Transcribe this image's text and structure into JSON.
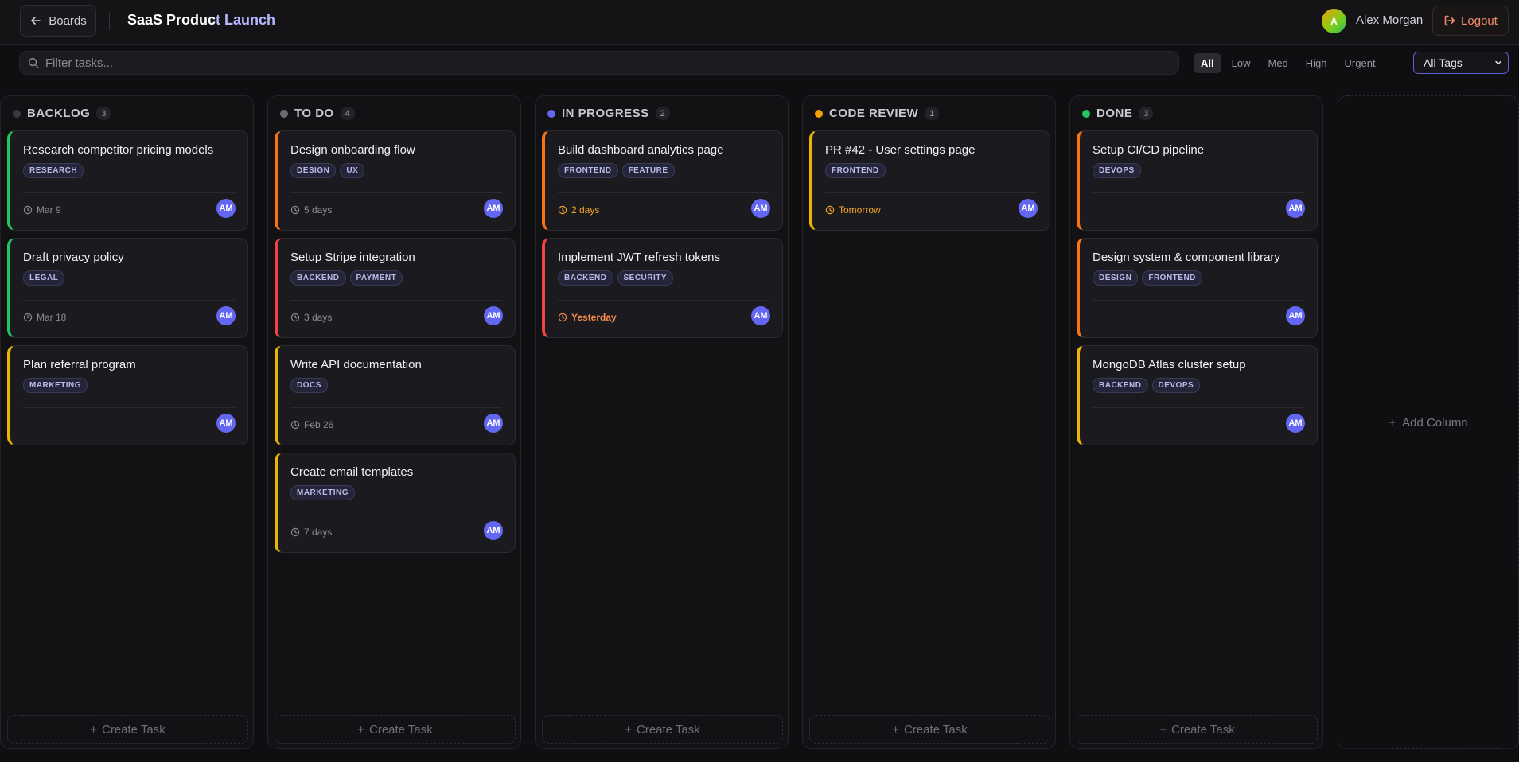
{
  "header": {
    "back_label": "Boards",
    "title_main": "SaaS Produc",
    "title_accent": "t Launch",
    "user_initial": "A",
    "user_name": "Alex Morgan",
    "logout_label": "Logout"
  },
  "toolbar": {
    "search_placeholder": "Filter tasks...",
    "priorities": [
      "All",
      "Low",
      "Med",
      "High",
      "Urgent"
    ],
    "active_priority": "All",
    "tag_filter_value": "All Tags"
  },
  "columns": [
    {
      "title": "BACKLOG",
      "count": "3",
      "dot_color": "#3a3a40",
      "cards": [
        {
          "title": "Research competitor pricing models",
          "tags": [
            "RESEARCH"
          ],
          "due": "Mar 9",
          "due_style": "normal",
          "border": "#22c55e",
          "assignee": "AM"
        },
        {
          "title": "Draft privacy policy",
          "tags": [
            "LEGAL"
          ],
          "due": "Mar 18",
          "due_style": "normal",
          "border": "#22c55e",
          "assignee": "AM"
        },
        {
          "title": "Plan referral program",
          "tags": [
            "MARKETING"
          ],
          "due": "",
          "due_style": "none",
          "border": "#eab308",
          "assignee": "AM"
        }
      ]
    },
    {
      "title": "TO DO",
      "count": "4",
      "dot_color": "#6b6b74",
      "cards": [
        {
          "title": "Design onboarding flow",
          "tags": [
            "DESIGN",
            "UX"
          ],
          "due": "5 days",
          "due_style": "normal",
          "border": "#f97316",
          "assignee": "AM"
        },
        {
          "title": "Setup Stripe integration",
          "tags": [
            "BACKEND",
            "PAYMENT"
          ],
          "due": "3 days",
          "due_style": "normal",
          "border": "#ef4444",
          "assignee": "AM"
        },
        {
          "title": "Write API documentation",
          "tags": [
            "DOCS"
          ],
          "due": "Feb 26",
          "due_style": "normal",
          "border": "#eab308",
          "assignee": "AM"
        },
        {
          "title": "Create email templates",
          "tags": [
            "MARKETING"
          ],
          "due": "7 days",
          "due_style": "normal",
          "border": "#eab308",
          "assignee": "AM"
        }
      ]
    },
    {
      "title": "IN PROGRESS",
      "count": "2",
      "dot_color": "#6366f1",
      "cards": [
        {
          "title": "Build dashboard analytics page",
          "tags": [
            "FRONTEND",
            "FEATURE"
          ],
          "due": "2 days",
          "due_style": "warn",
          "border": "#f97316",
          "assignee": "AM"
        },
        {
          "title": "Implement JWT refresh tokens",
          "tags": [
            "BACKEND",
            "SECURITY"
          ],
          "due": "Yesterday",
          "due_style": "late",
          "border": "#ef4444",
          "assignee": "AM"
        }
      ]
    },
    {
      "title": "CODE REVIEW",
      "count": "1",
      "dot_color": "#f59e0b",
      "cards": [
        {
          "title": "PR #42 - User settings page",
          "tags": [
            "FRONTEND"
          ],
          "due": "Tomorrow",
          "due_style": "warn",
          "border": "#eab308",
          "assignee": "AM"
        }
      ]
    },
    {
      "title": "DONE",
      "count": "3",
      "dot_color": "#22c55e",
      "cards": [
        {
          "title": "Setup CI/CD pipeline",
          "tags": [
            "DEVOPS"
          ],
          "due": "",
          "due_style": "none",
          "border": "#f97316",
          "assignee": "AM"
        },
        {
          "title": "Design system & component library",
          "tags": [
            "DESIGN",
            "FRONTEND"
          ],
          "due": "",
          "due_style": "none",
          "border": "#f97316",
          "assignee": "AM"
        },
        {
          "title": "MongoDB Atlas cluster setup",
          "tags": [
            "BACKEND",
            "DEVOPS"
          ],
          "due": "",
          "due_style": "none",
          "border": "#eab308",
          "assignee": "AM"
        }
      ]
    }
  ],
  "create_task_label": "Create Task",
  "add_column_label": "Add Column"
}
